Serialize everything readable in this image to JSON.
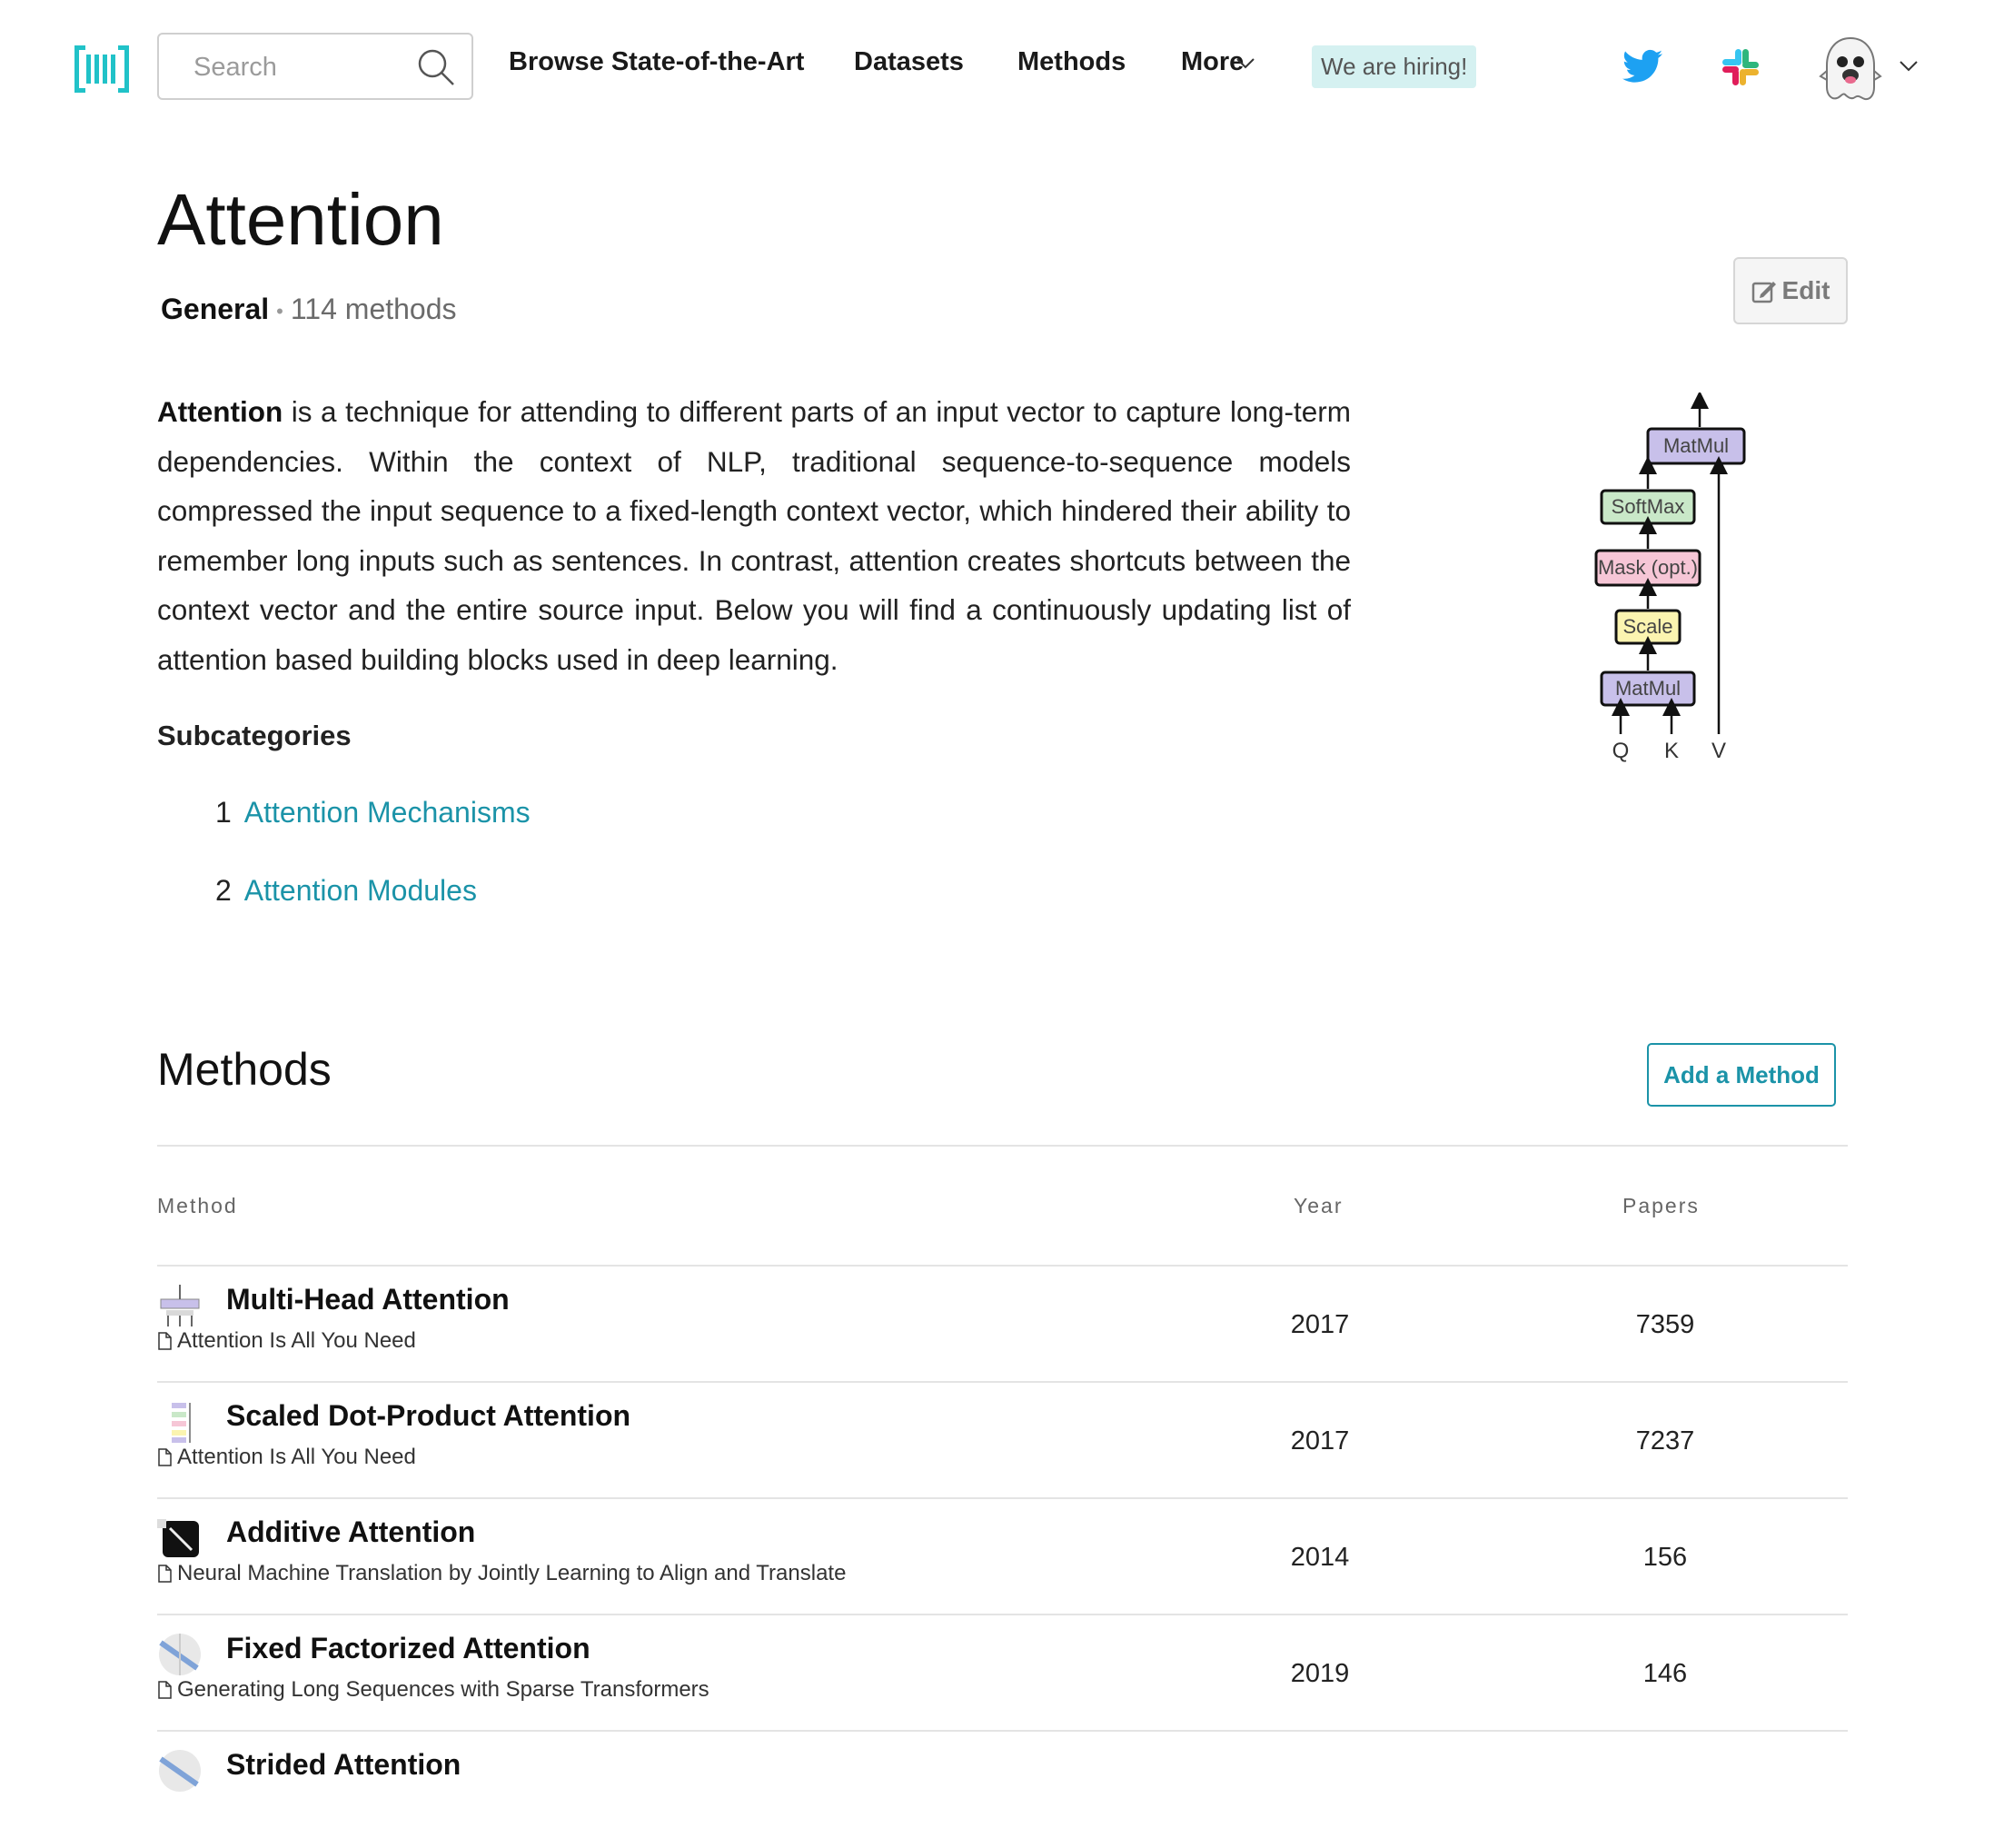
{
  "nav": {
    "search_placeholder": "Search",
    "links": [
      "Browse State-of-the-Art",
      "Datasets",
      "Methods",
      "More"
    ],
    "hiring": "We are hiring!",
    "accent": "#21c2c8"
  },
  "header": {
    "title": "Attention",
    "area": "General",
    "count": "114 methods",
    "edit_label": "Edit"
  },
  "description": {
    "bold": "Attention",
    "text": " is a technique for attending to different parts of an input vector to capture long-term dependencies. Within the context of NLP, traditional sequence-to-sequence models compressed the input sequence to a fixed-length context vector, which hindered their ability to remember long inputs such as sentences. In contrast, attention creates shortcuts between the context vector and the entire source input. Below you will find a continuously updating list of attention based building blocks used in deep learning."
  },
  "subcategories": {
    "title": "Subcategories",
    "items": [
      {
        "num": "1",
        "label": "Attention Mechanisms"
      },
      {
        "num": "2",
        "label": "Attention Modules"
      }
    ]
  },
  "diagram": {
    "boxes": [
      "MatMul",
      "SoftMax",
      "Mask (opt.)",
      "Scale",
      "MatMul"
    ],
    "inputs": [
      "Q",
      "K",
      "V"
    ],
    "colors": {
      "matmul": "#c8c0ea",
      "softmax": "#c9e8c8",
      "mask": "#f6c6d6",
      "scale": "#fbf4b0"
    }
  },
  "methods": {
    "title": "Methods",
    "add_label": "Add a Method",
    "columns": [
      "Method",
      "Year",
      "Papers"
    ],
    "rows": [
      {
        "name": "Multi-Head Attention",
        "paper": "Attention Is All You Need",
        "year": "2017",
        "papers": "7359"
      },
      {
        "name": "Scaled Dot-Product Attention",
        "paper": "Attention Is All You Need",
        "year": "2017",
        "papers": "7237"
      },
      {
        "name": "Additive Attention",
        "paper": "Neural Machine Translation by Jointly Learning to Align and Translate",
        "year": "2014",
        "papers": "156"
      },
      {
        "name": "Fixed Factorized Attention",
        "paper": "Generating Long Sequences with Sparse Transformers",
        "year": "2019",
        "papers": "146"
      },
      {
        "name": "Strided Attention",
        "paper": "",
        "year": "",
        "papers": ""
      }
    ]
  }
}
